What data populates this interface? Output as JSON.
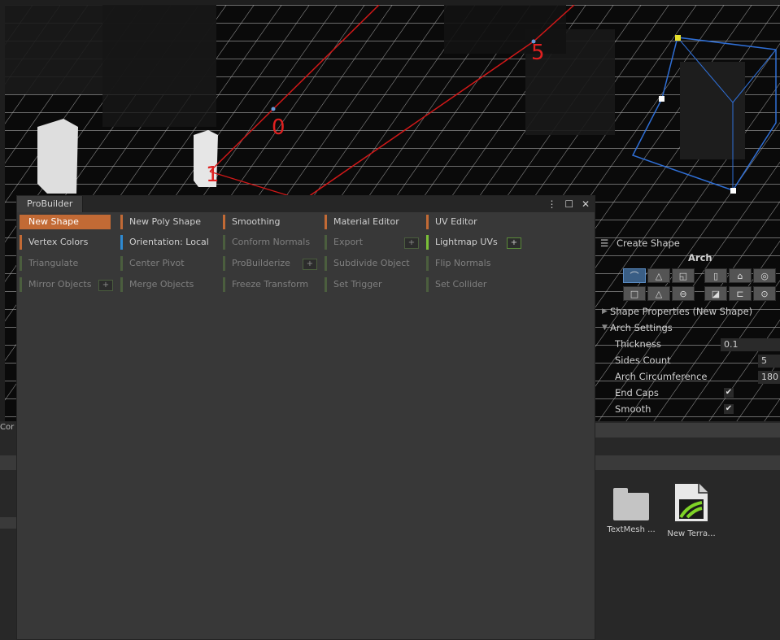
{
  "scene": {
    "labels": [
      "0",
      "1",
      "5"
    ]
  },
  "probuilder": {
    "title": "ProBuilder",
    "window_controls": {
      "menu": "⋮",
      "maximize": "☐",
      "close": "✕"
    },
    "tools": [
      {
        "id": "new-shape",
        "label": "New Shape"
      },
      {
        "id": "new-poly-shape",
        "label": "New Poly Shape"
      },
      {
        "id": "smoothing",
        "label": "Smoothing"
      },
      {
        "id": "material-editor",
        "label": "Material Editor"
      },
      {
        "id": "uv-editor",
        "label": "UV Editor"
      },
      {
        "id": "vertex-colors",
        "label": "Vertex Colors"
      },
      {
        "id": "orientation",
        "label": "Orientation: Local"
      },
      {
        "id": "conform-normals",
        "label": "Conform Normals"
      },
      {
        "id": "export",
        "label": "Export"
      },
      {
        "id": "lightmap-uvs",
        "label": "Lightmap UVs"
      },
      {
        "id": "triangulate",
        "label": "Triangulate"
      },
      {
        "id": "center-pivot",
        "label": "Center Pivot"
      },
      {
        "id": "probuilderize",
        "label": "ProBuilderize"
      },
      {
        "id": "subdivide-object",
        "label": "Subdivide Object"
      },
      {
        "id": "flip-normals",
        "label": "Flip Normals"
      },
      {
        "id": "mirror-objects",
        "label": "Mirror Objects"
      },
      {
        "id": "merge-objects",
        "label": "Merge Objects"
      },
      {
        "id": "freeze-transform",
        "label": "Freeze Transform"
      },
      {
        "id": "set-trigger",
        "label": "Set Trigger"
      },
      {
        "id": "set-collider",
        "label": "Set Collider"
      }
    ],
    "plus_label": "+"
  },
  "create_shape": {
    "header": "Create Shape",
    "shape_name": "Arch",
    "shape_properties": "Shape Properties (New Shape)",
    "arch_settings": "Arch Settings",
    "props": {
      "thickness_label": "Thickness",
      "thickness_value": "0.1",
      "sides_label": "Sides Count",
      "sides_value": "5",
      "circ_label": "Arch Circumference",
      "circ_value": "180",
      "endcaps_label": "End Caps",
      "smooth_label": "Smooth",
      "check": "✔"
    }
  },
  "assets": {
    "items": [
      {
        "label": "TextMesh ..."
      },
      {
        "label": "New Terra..."
      }
    ]
  },
  "left_tab": "Cor"
}
